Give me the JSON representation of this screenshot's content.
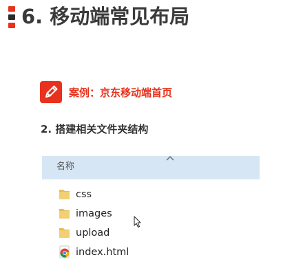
{
  "slide": {
    "title": "6. 移动端常见布局",
    "case_label": "案例：京东移动端首页",
    "step_heading": "2. 搭建相关文件夹结构"
  },
  "explorer": {
    "column_header": "名称",
    "files": [
      {
        "name": "css",
        "icon": "folder-icon"
      },
      {
        "name": "images",
        "icon": "folder-icon"
      },
      {
        "name": "upload",
        "icon": "folder-icon"
      },
      {
        "name": "index.html",
        "icon": "chrome-html-icon"
      }
    ]
  },
  "colors": {
    "accent_red": "#e8321d",
    "case_text_red": "#e8321d",
    "bullet_dark": "#2b2b2b",
    "header_blue": "#d6e6f4",
    "folder_yellow": "#f3cf73"
  }
}
